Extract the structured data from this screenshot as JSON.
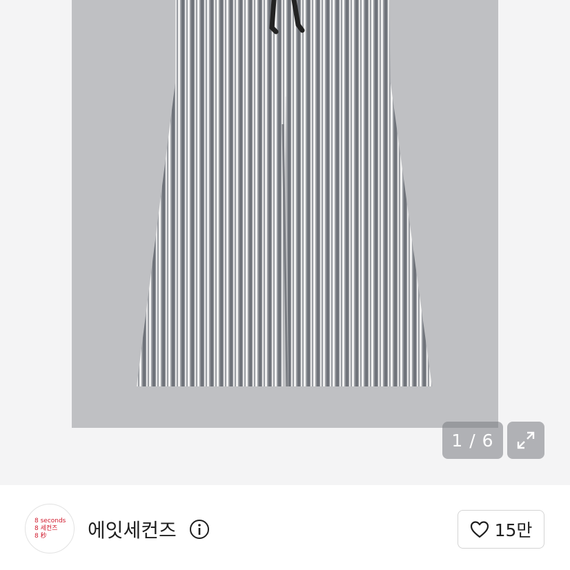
{
  "gallery": {
    "counter": "1 / 6",
    "expand_icon": "expand-icon",
    "product_image": "striped-wide-pants"
  },
  "shop": {
    "logo": {
      "line1": "8 seconds",
      "line2": "8 세컨즈",
      "line3": "8 秒",
      "color": "#d0172a"
    },
    "name": "에잇세컨즈",
    "info_icon": "info-icon",
    "like_icon": "heart-icon",
    "like_count": "15만"
  }
}
